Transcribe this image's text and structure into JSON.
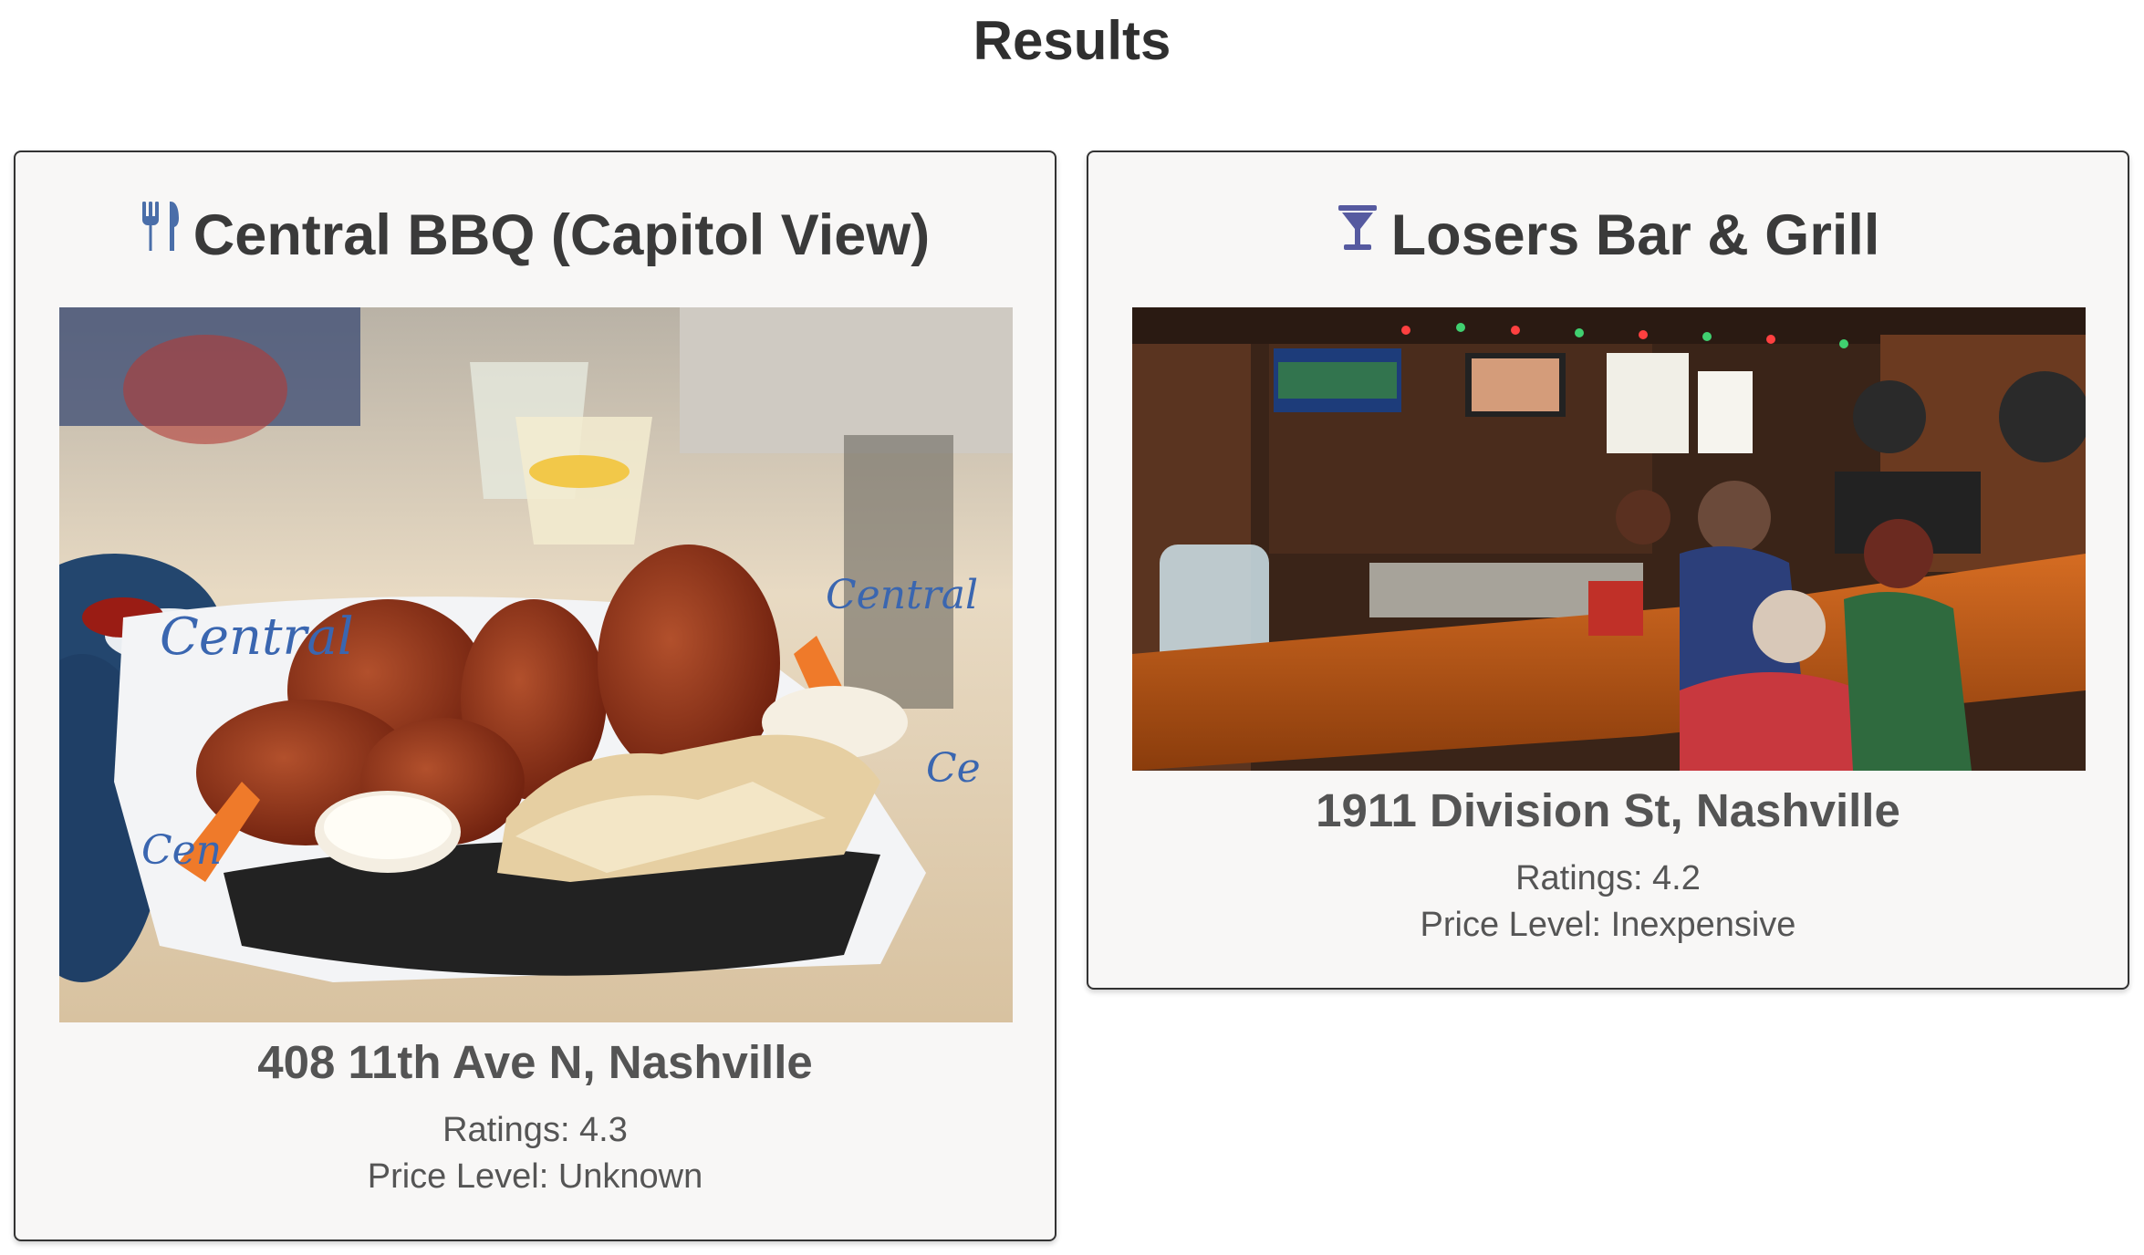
{
  "page": {
    "title": "Results"
  },
  "results": [
    {
      "name": "Central BBQ (Capitol View)",
      "icon": "utensils-icon",
      "photo": "bbq-wings-basket-photo",
      "address": "408 11th Ave N, Nashville",
      "rating_text": "Ratings: 4.3",
      "price_text": "Price Level: Unknown"
    },
    {
      "name": "Losers Bar & Grill",
      "icon": "cocktail-icon",
      "photo": "bar-interior-photo",
      "address": "1911 Division St, Nashville",
      "rating_text": "Ratings: 4.2",
      "price_text": "Price Level: Inexpensive"
    }
  ],
  "colors": {
    "icon_blue": "#4a6ea9",
    "icon_purple": "#565aa0",
    "card_bg": "#f8f7f6",
    "border": "#333333"
  }
}
